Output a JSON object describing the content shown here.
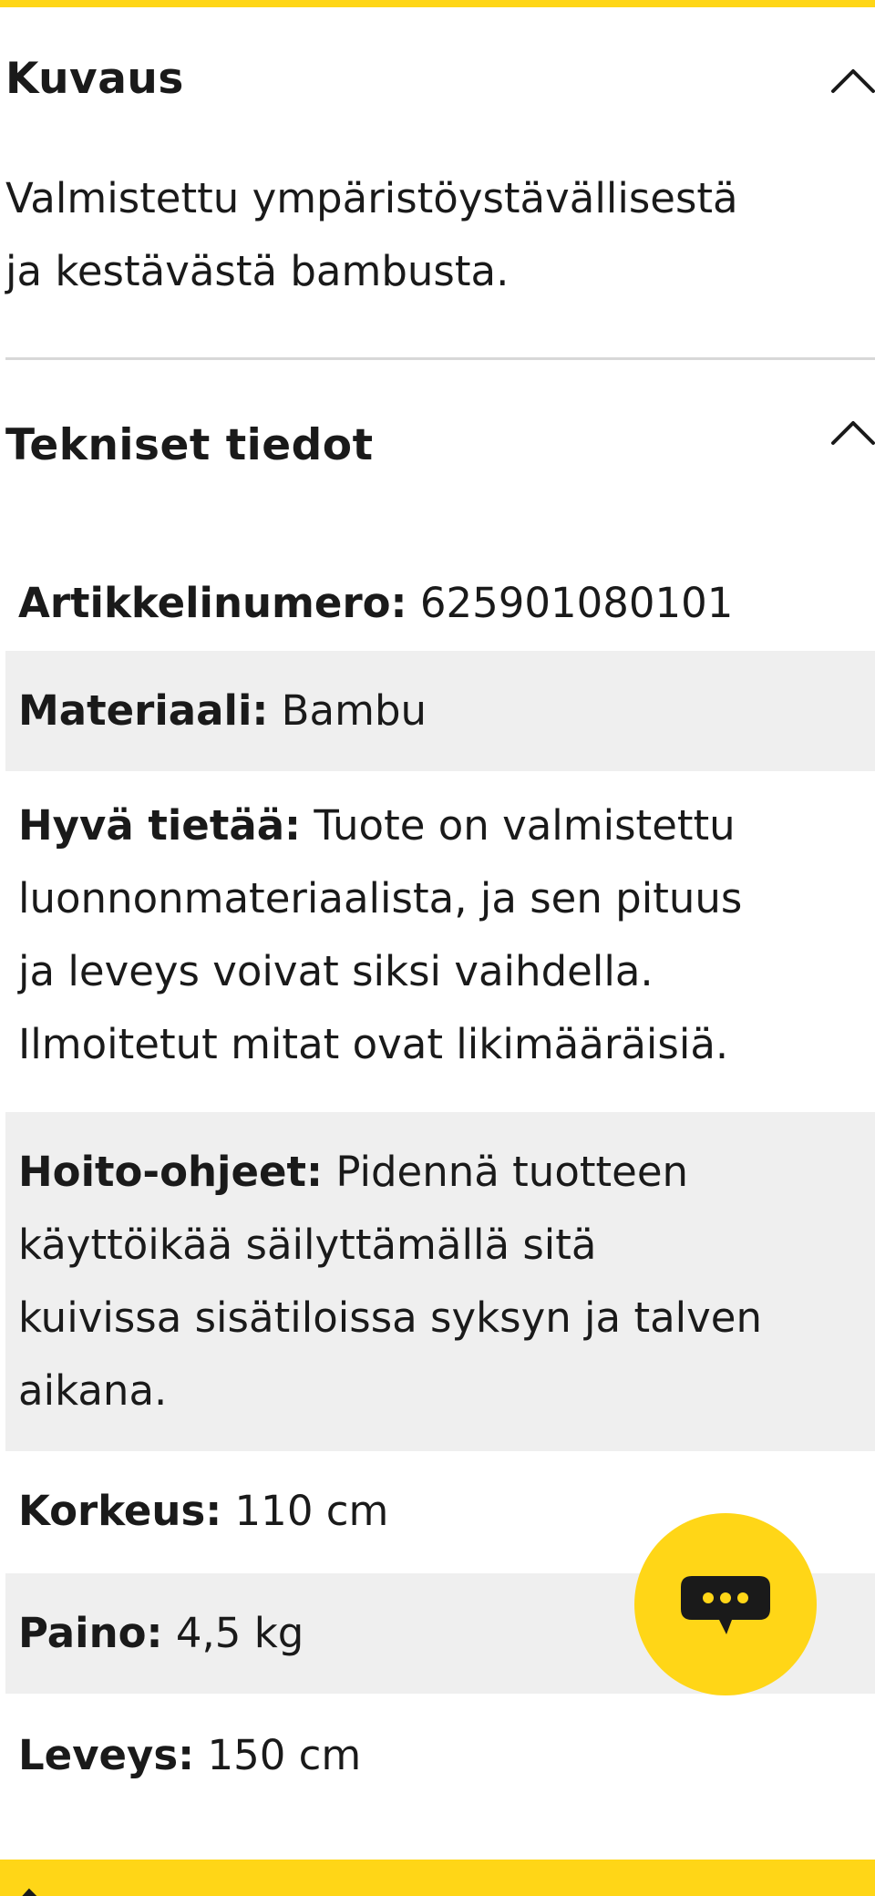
{
  "description_section": {
    "title": "Kuvaus",
    "text_lines": [
      "Valmistettu ympäristöystävällisestä",
      "ja kestävästä bambusta."
    ]
  },
  "specs_section": {
    "title": "Tekniset tiedot",
    "rows": [
      {
        "label": "Artikkelinumero:",
        "lines": [
          " 625901080101"
        ]
      },
      {
        "label": "Materiaali:",
        "lines": [
          " Bambu"
        ]
      },
      {
        "label": "Hyvä tietää:",
        "lines": [
          " Tuote on valmistettu",
          "luonnonmateriaalista, ja sen pituus",
          "ja leveys voivat siksi vaihdella.",
          "Ilmoitetut mitat ovat likimääräisiä."
        ]
      },
      {
        "label": "Hoito-ohjeet:",
        "lines": [
          " Pidennä tuotteen",
          "käyttöikää säilyttämällä sitä",
          "kuivissa sisätiloissa syksyn ja talven",
          "aikana."
        ]
      },
      {
        "label": "Korkeus:",
        "lines": [
          " 110 cm"
        ]
      },
      {
        "label": "Paino:",
        "lines": [
          " 4,5 kg"
        ]
      },
      {
        "label": "Leveys:",
        "lines": [
          " 150 cm"
        ]
      }
    ]
  },
  "icons": {
    "collapse_description": "chevron-up-icon",
    "collapse_specs": "chevron-up-icon",
    "chat": "chat-bubble-icon"
  },
  "colors": {
    "accent": "#ffd617",
    "shaded_row": "#efefef",
    "divider": "#d8d8d8",
    "text": "#1a1a1a"
  }
}
